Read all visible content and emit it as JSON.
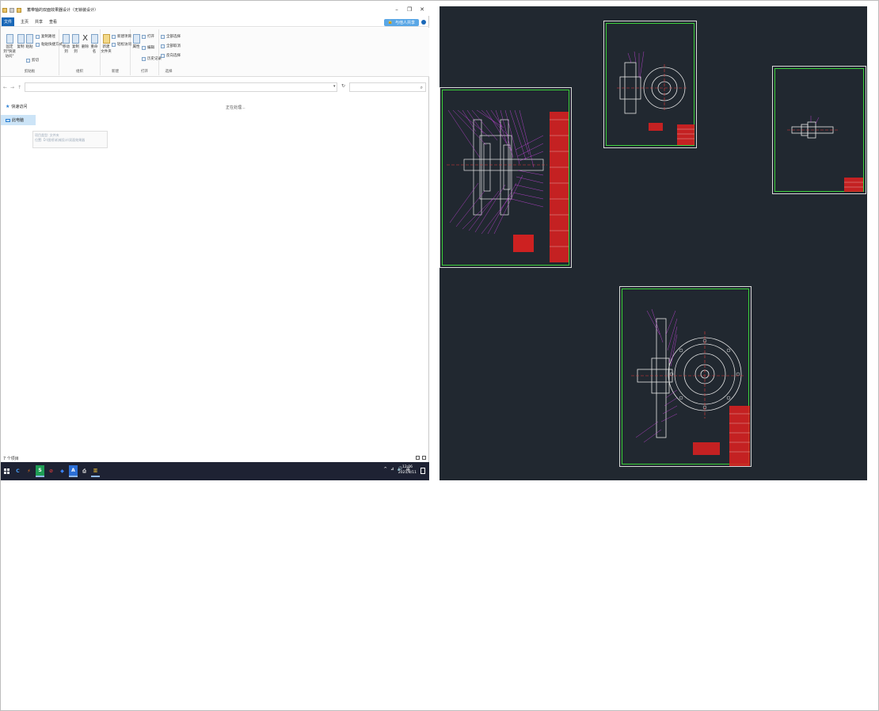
{
  "explorer": {
    "title": "蓄带轴的双面效果器设计（无锁装设计）",
    "window_controls": [
      "–",
      "❐",
      "✕"
    ],
    "menu": {
      "file": "文件",
      "items": [
        "主页",
        "共享",
        "查看"
      ]
    },
    "share_label": "与他人共享",
    "ribbon": {
      "clipboard": {
        "label": "剪贴板",
        "pin": "固定到\"快速访问\"",
        "copy": "复制",
        "paste": "粘贴",
        "copy_path": "复制路径",
        "paste_shortcut": "粘贴快捷方式",
        "cut": "剪切"
      },
      "organize": {
        "label": "组织",
        "move_to": "移动到",
        "copy_to": "复制到",
        "delete": "删除",
        "rename": "重命名"
      },
      "new": {
        "label": "新建",
        "new_folder": "新建\n文件夹",
        "new_item": "新建项目",
        "easy_access": "轻松访问"
      },
      "open": {
        "label": "打开",
        "properties": "属性",
        "open": "打开",
        "edit": "编辑",
        "history": "历史记录"
      },
      "select": {
        "label": "选择",
        "select_all": "全部选择",
        "select_none": "全部取消",
        "invert": "反向选择"
      }
    },
    "nav": {
      "quick_access": "快速访问",
      "this_pc": "此电脑"
    },
    "searching_text": "正在处理...",
    "tooltip": {
      "line1": "项目类型: 文件夹",
      "line2": "位置: D:\\图纸\\机械设计\\双面效果器"
    },
    "status": "7 个项目"
  },
  "taskbar": {
    "apps": [
      "C",
      "⚡",
      "S",
      "⊘",
      "◆",
      "A",
      "⎙",
      "▥"
    ],
    "tray": [
      "^",
      "⊿",
      "🔊",
      "英"
    ],
    "time": "12:06",
    "date": "2021/8/11"
  },
  "cad_sheets": [
    {
      "name": "assembly-drawing"
    },
    {
      "name": "gear-part-drawing"
    },
    {
      "name": "shaft-part-drawing"
    },
    {
      "name": "flywheel-assembly-drawing"
    }
  ],
  "colors": {
    "accent": "#1a68b8",
    "cad_bg": "#212830",
    "frame": "#3bd13b",
    "annotation": "#d046e8",
    "title_block": "#e02020"
  }
}
